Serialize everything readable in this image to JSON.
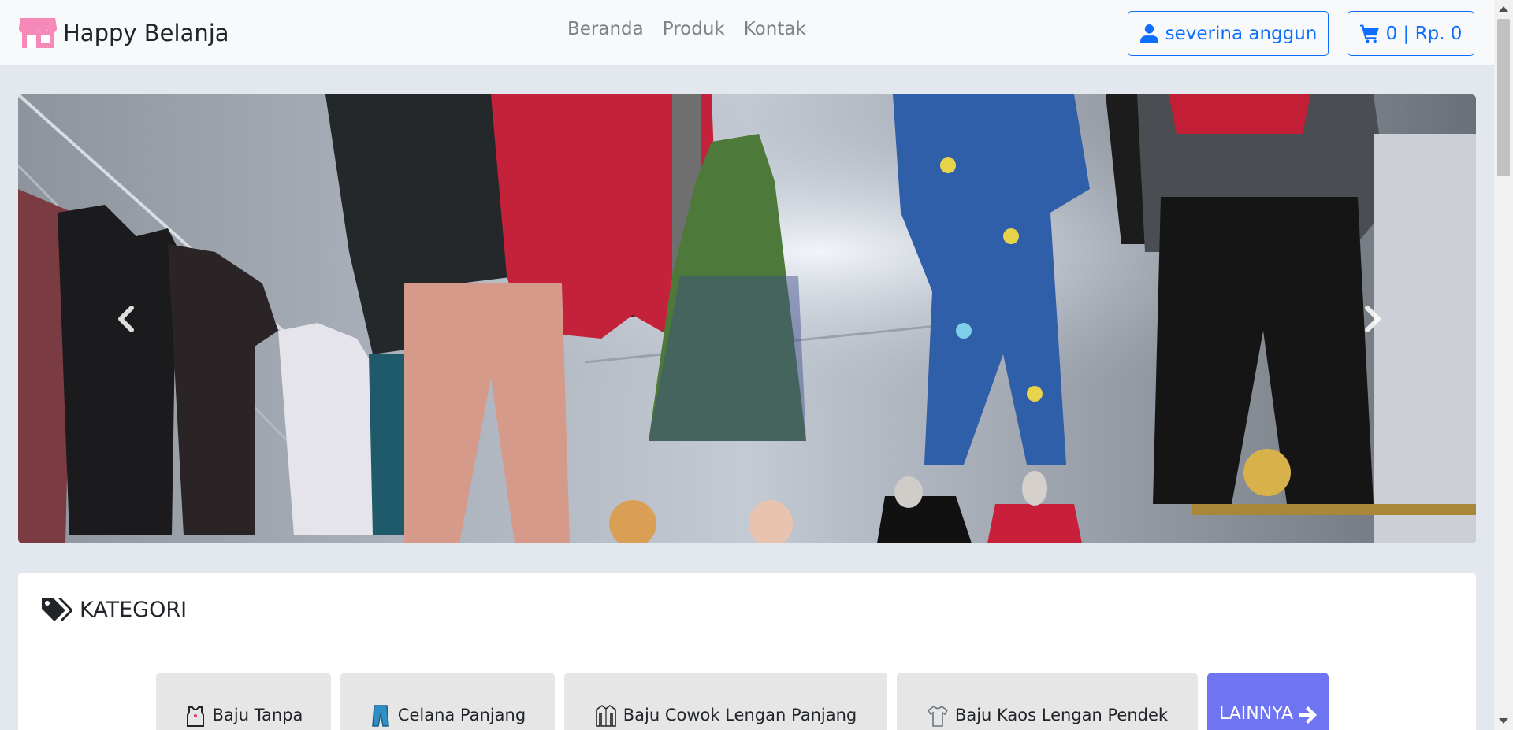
{
  "navbar": {
    "brand": "Happy Belanja",
    "links": [
      "Beranda",
      "Produk",
      "Kontak"
    ],
    "user_label": "severina anggun",
    "cart_label": "0 | Rp. 0"
  },
  "section": {
    "title": "KATEGORI"
  },
  "categories": [
    {
      "label": "Baju Tanpa"
    },
    {
      "label": "Celana Panjang"
    },
    {
      "label": "Baju Cowok Lengan Panjang"
    },
    {
      "label": "Baju Kaos Lengan Pendek"
    }
  ],
  "more_label": "LAINNYA",
  "colors": {
    "primary": "#0d6efd",
    "brand_icon": "#f58ab8",
    "more_button": "#6f74f2"
  }
}
